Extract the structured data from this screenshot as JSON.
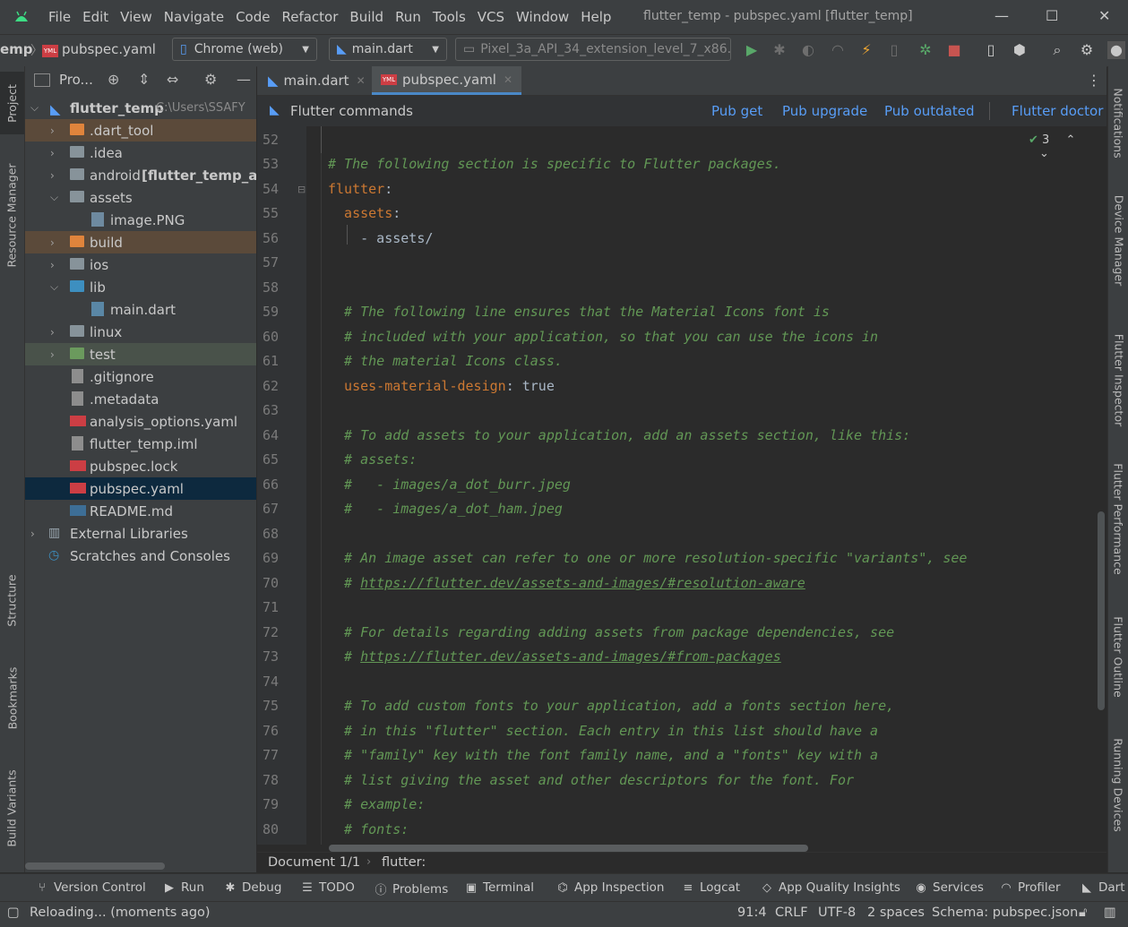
{
  "menubar": {
    "items": [
      "File",
      "Edit",
      "View",
      "Navigate",
      "Code",
      "Refactor",
      "Build",
      "Run",
      "Tools",
      "VCS",
      "Window",
      "Help"
    ],
    "window_title": "flutter_temp - pubspec.yaml [flutter_temp]",
    "minimize_glyph": "—",
    "maximize_glyph": "☐",
    "close_glyph": "✕"
  },
  "navbar": {
    "crumb_project": "emp",
    "crumb_file": "pubspec.yaml",
    "device": "Chrome (web)",
    "run_config": "main.dart",
    "emulator": "Pixel_3a_API_34_extension_level_7_x86..."
  },
  "left_stripe": {
    "tabs": [
      "Project",
      "Resource Manager",
      "Structure",
      "Bookmarks",
      "Build Variants"
    ]
  },
  "project_panel": {
    "title": "Pro...",
    "root_name": "flutter_temp",
    "root_path": "C:\\Users\\SSAFY",
    "items": [
      {
        "label": "flutter_temp",
        "extra": "C:\\Users\\SSAFY"
      },
      {
        "label": ".dart_tool"
      },
      {
        "label": ".idea"
      },
      {
        "label": "android",
        "extra": "[flutter_temp_andr"
      },
      {
        "label": "assets"
      },
      {
        "label": "image.PNG"
      },
      {
        "label": "build"
      },
      {
        "label": "ios"
      },
      {
        "label": "lib"
      },
      {
        "label": "main.dart"
      },
      {
        "label": "linux"
      },
      {
        "label": "test"
      },
      {
        "label": ".gitignore"
      },
      {
        "label": ".metadata"
      },
      {
        "label": "analysis_options.yaml"
      },
      {
        "label": "flutter_temp.iml"
      },
      {
        "label": "pubspec.lock"
      },
      {
        "label": "pubspec.yaml"
      },
      {
        "label": "README.md"
      },
      {
        "label": "External Libraries"
      },
      {
        "label": "Scratches and Consoles"
      }
    ]
  },
  "editor": {
    "tabs": [
      {
        "label": "main.dart"
      },
      {
        "label": "pubspec.yaml"
      }
    ],
    "flutter_bar": {
      "title": "Flutter commands",
      "pub_get": "Pub get",
      "pub_upgrade": "Pub upgrade",
      "pub_outdated": "Pub outdated",
      "flutter_doctor": "Flutter doctor"
    },
    "inspection_count": "3",
    "line_numbers": [
      "52",
      "53",
      "54",
      "55",
      "56",
      "57",
      "58",
      "59",
      "60",
      "61",
      "62",
      "63",
      "64",
      "65",
      "66",
      "67",
      "68",
      "69",
      "70",
      "71",
      "72",
      "73",
      "74",
      "75",
      "76",
      "77",
      "78",
      "79",
      "80"
    ],
    "lines": {
      "l53": "# The following section is specific to Flutter packages.",
      "l54_key": "flutter",
      "l54_colon": ":",
      "l55_key": "  assets",
      "l55_colon": ":",
      "l56": "    - assets/",
      "l59": "  # The following line ensures that the Material Icons font is",
      "l60": "  # included with your application, so that you can use the icons in",
      "l61": "  # the material Icons class.",
      "l62_key": "  uses-material-design",
      "l62_val": ": true",
      "l64": "  # To add assets to your application, add an assets section, like this:",
      "l65": "  # assets:",
      "l66": "  #   - images/a_dot_burr.jpeg",
      "l67": "  #   - images/a_dot_ham.jpeg",
      "l69": "  # An image asset can refer to one or more resolution-specific \"variants\", see",
      "l70_prefix": "  # ",
      "l70_link": "https://flutter.dev/assets-and-images/#resolution-aware",
      "l72": "  # For details regarding adding assets from package dependencies, see",
      "l73_prefix": "  # ",
      "l73_link": "https://flutter.dev/assets-and-images/#from-packages",
      "l75": "  # To add custom fonts to your application, add a fonts section here,",
      "l76": "  # in this \"flutter\" section. Each entry in this list should have a",
      "l77": "  # \"family\" key with the font family name, and a \"fonts\" key with a",
      "l78": "  # list giving the asset and other descriptors for the font. For",
      "l79": "  # example:",
      "l80": "  # fonts:"
    },
    "breadcrumb": [
      "Document 1/1",
      "flutter:"
    ]
  },
  "right_stripe": {
    "tabs": [
      "Notifications",
      "Device Manager",
      "Flutter Inspector",
      "Flutter Performance",
      "Flutter Outline",
      "Running Devices"
    ]
  },
  "tool_windows": [
    {
      "label": "Version Control",
      "icon": "branch-icon"
    },
    {
      "label": "Run",
      "icon": "play-icon"
    },
    {
      "label": "Debug",
      "icon": "bug-icon"
    },
    {
      "label": "TODO",
      "icon": "list-icon"
    },
    {
      "label": "Problems",
      "icon": "warning-icon"
    },
    {
      "label": "Terminal",
      "icon": "terminal-icon"
    },
    {
      "label": "App Inspection",
      "icon": "inspection-icon"
    },
    {
      "label": "Logcat",
      "icon": "logcat-icon"
    },
    {
      "label": "App Quality Insights",
      "icon": "diamond-icon"
    },
    {
      "label": "Services",
      "icon": "services-icon"
    },
    {
      "label": "Profiler",
      "icon": "gauge-icon"
    },
    {
      "label": "Dart",
      "icon": "dart-icon"
    }
  ],
  "statusbar": {
    "message": "Reloading... (moments ago)",
    "position": "91:4",
    "line_sep": "CRLF",
    "encoding": "UTF-8",
    "indent": "2 spaces",
    "schema": "Schema: pubspec.json"
  },
  "colors": {
    "bg": "#2b2b2b",
    "panel": "#3c3f41",
    "comment": "#629755",
    "keyword": "#cc7832",
    "link": "#589df6"
  }
}
